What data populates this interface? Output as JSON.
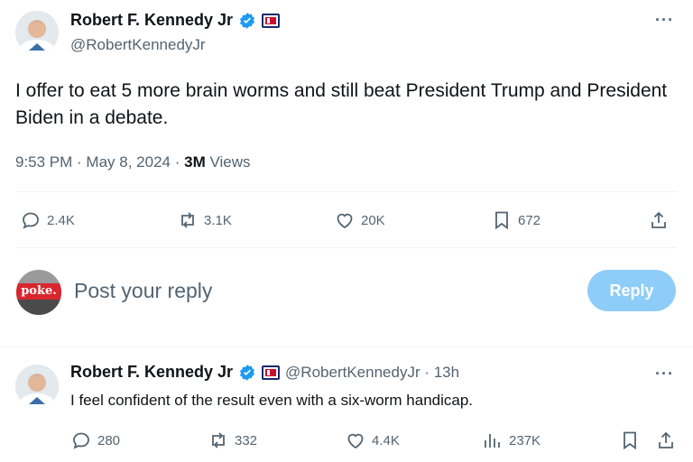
{
  "post": {
    "author_name": "Robert F. Kennedy Jr",
    "handle": "@RobertKennedyJr",
    "text": "I offer to eat 5 more brain worms and still beat President Trump and President Biden in a debate.",
    "time": "9:53 PM · May 8, 2024 ·",
    "views_count": "3M",
    "views_label": "Views",
    "more_label": "···",
    "actions": {
      "replies": "2.4K",
      "reposts": "3.1K",
      "likes": "20K",
      "bookmarks": "672"
    }
  },
  "compose": {
    "placeholder": "Post your reply",
    "button_label": "Reply",
    "avatar_text": "poke."
  },
  "reply": {
    "author_name": "Robert F. Kennedy Jr",
    "handle_time": "@RobertKennedyJr · 13h",
    "text": "I feel confident of the result even with a six-worm handicap.",
    "more_label": "···",
    "actions": {
      "replies": "280",
      "reposts": "332",
      "likes": "4.4K",
      "views": "237K"
    }
  },
  "colors": {
    "verified": "#1d9bf0",
    "reply_button": "#8ecdf8",
    "muted_text": "#536471"
  }
}
